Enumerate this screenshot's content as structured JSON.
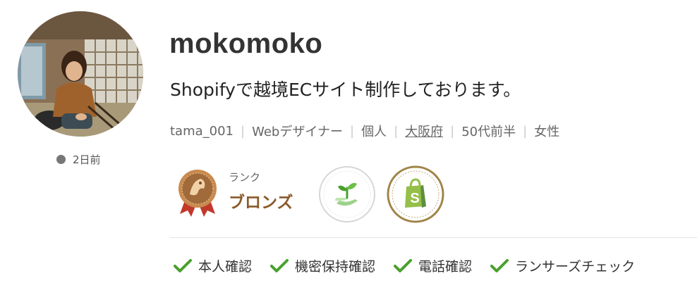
{
  "profile": {
    "username": "mokomoko",
    "tagline": "Shopifyで越境ECサイト制作しております。",
    "last_login": "2日前",
    "status_color": "#777777"
  },
  "meta": {
    "user_id": "tama_001",
    "occupation": "Webデザイナー",
    "type": "個人",
    "location": "大阪府",
    "age": "50代前半",
    "gender": "女性"
  },
  "rank": {
    "label": "ランク",
    "value": "ブロンズ",
    "color": "#8a5a2b"
  },
  "badges": [
    {
      "icon": "sprout-badge-icon"
    },
    {
      "icon": "shopify-badge-icon"
    }
  ],
  "verifications": [
    {
      "label": "本人確認",
      "icon": "check-icon"
    },
    {
      "label": "機密保持確認",
      "icon": "check-icon"
    },
    {
      "label": "電話確認",
      "icon": "check-icon"
    },
    {
      "label": "ランサーズチェック",
      "icon": "check-icon"
    }
  ],
  "colors": {
    "check": "#4aa02c",
    "bronze": "#a06a3a",
    "ribbon": "#c0392b"
  }
}
